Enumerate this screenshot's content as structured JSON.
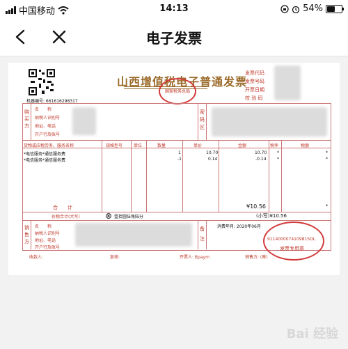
{
  "status_bar": {
    "carrier": "中国移动",
    "time": "14:13",
    "battery": "54%",
    "battery_level": 0.54
  },
  "nav": {
    "title": "电子发票",
    "back_icon": "chevron-left-icon",
    "close_icon": "close-icon"
  },
  "invoice": {
    "title": "山西增值税电子普通发票",
    "seal_text": "国家税务总局",
    "machine_no": "机器编号: 661616298317",
    "right_labels": [
      "发票代码",
      "发票号码",
      "开票日期",
      "校 验 码"
    ],
    "buyer_side": "购买方",
    "buyer_rows": [
      "名　　称",
      "纳税人识别号",
      "地址、电话",
      "开户行及账号"
    ],
    "password_area": "密码区",
    "columns": [
      "货物或应税劳务、服务名称",
      "规格型号",
      "单位",
      "数量",
      "单价",
      "金额",
      "税率",
      "税额"
    ],
    "items": [
      {
        "name": "*电信服务*通信服务费",
        "qty": "1",
        "price": "10.70",
        "amount": "10.70",
        "rate": "*",
        "tax": "*"
      },
      {
        "name": "*电信服务*通信服务费",
        "qty": "-1",
        "price": "0.14",
        "amount": "-0.14",
        "rate": "*",
        "tax": "*"
      }
    ],
    "total_label": "合　　计",
    "total_amount": "¥10.56",
    "total_tax": "*",
    "price_tax_label": "价税合计(大写)",
    "price_tax_words": "壹拾圆伍角陆分",
    "price_tax_small": "(小写)¥10.56",
    "seller_side": "销售方",
    "seller_rows": [
      "名　　称",
      "纳税人识别号",
      "地址、电话",
      "开户行及账号"
    ],
    "remark_label": "备注",
    "remark_text": "消费年月: 2020年06月",
    "seller_seal_code": "911400007410981SOL",
    "seller_seal_title": "发票专用章",
    "payee": "收款人:",
    "reviewer": "复核:",
    "issuer": "开票人: Bpaym",
    "seller_footer": "销售方: (章)"
  },
  "watermark": "Bai 经验"
}
